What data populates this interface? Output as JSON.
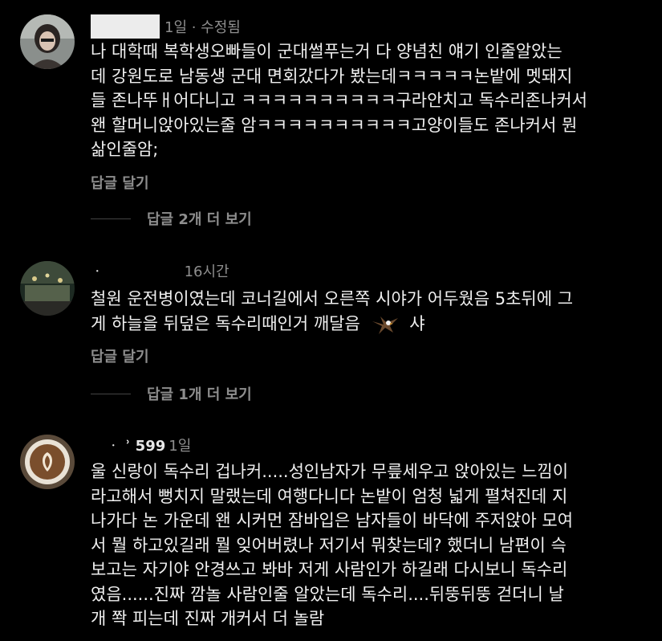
{
  "comments": [
    {
      "username": "",
      "time": "1일 · 수정됨",
      "lines": [
        "나 대학때 복학생오빠들이 군대썰푸는거 다 양념친 얘기 인줄알았는",
        "데 강원도로 남동생 군대 면회갔다가 봤는데ㅋㅋㅋㅋㅋ논밭에 멧돼지",
        "들 존나뚜ㅐ어다니고 ㅋㅋㅋㅋㅋㅋㅋㅋㅋㅋ구라안치고 독수리존나커서",
        "왠 할머니앉아있는줄 암ㅋㅋㅋㅋㅋㅋㅋㅋㅋㅋ고양이들도 존나커서 뭔",
        "삶인줄암;"
      ],
      "reply_label": "답글 달기",
      "more_replies_label": "답글 2개 더 보기"
    },
    {
      "username": "ᆞ",
      "time": "16시간",
      "lines": [
        "철원 운전병이였는데 코너길에서 오른쪽 시야가 어두웠음 5초뒤에 그",
        "게 하늘을 뒤덮은 독수리때인거 깨달음"
      ],
      "line2_tail": "샤",
      "reply_label": "답글 달기",
      "more_replies_label": "답글 1개 더 보기"
    },
    {
      "username": "ᆞ   ʾ 599",
      "time": "1일",
      "lines": [
        "울 신랑이 독수리 겁나커.....성인남자가 무릎세우고 앉아있는 느낌이",
        "라고해서 뻥치지 말랬는데 여행다니다 논밭이 엄청 넓게 펼쳐진데 지",
        "나가다 논 가운데 왠 시커먼 잠바입은 남자들이 바닥에 주저앉아 모여",
        "서 뭘 하고있길래 뭘 잊어버렸나 저기서 뭐찾는데? 했더니 남편이 슥",
        "보고는 자기야 안경쓰고 봐바 저게 사람인가 하길래 다시보니 독수리",
        "였음......진짜 깜놀 사람인줄 알았는데 독수리....뒤뚱뒤뚱 걷더니 날",
        "개 쫙 피는데 진짜 개커서 더 놀람"
      ]
    }
  ],
  "icons": {
    "eagle_emoji": "eagle-icon"
  }
}
